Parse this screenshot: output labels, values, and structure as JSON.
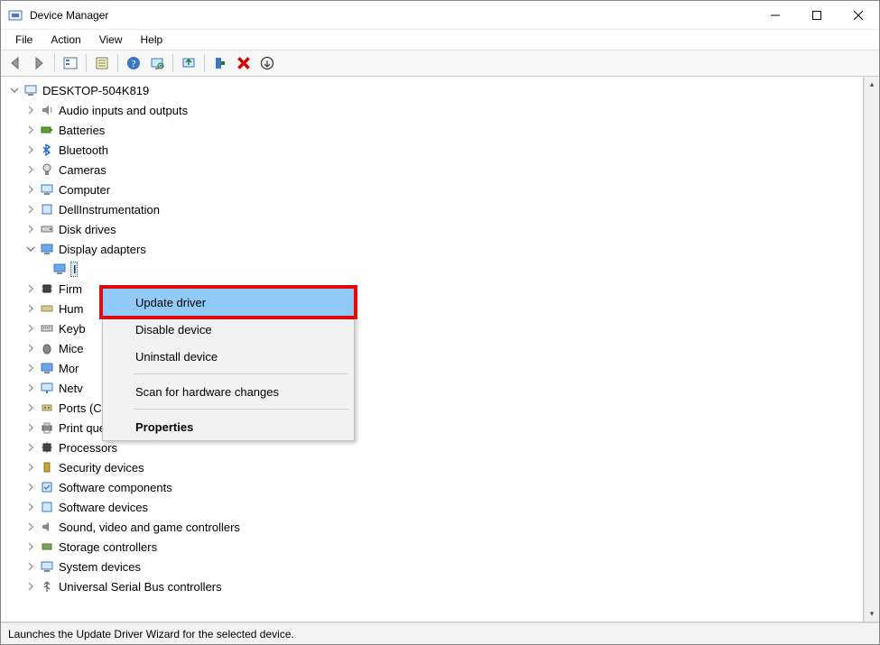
{
  "window": {
    "title": "Device Manager"
  },
  "menubar": {
    "items": [
      "File",
      "Action",
      "View",
      "Help"
    ]
  },
  "tree": {
    "root": "DESKTOP-504K819",
    "items": [
      "Audio inputs and outputs",
      "Batteries",
      "Bluetooth",
      "Cameras",
      "Computer",
      "DellInstrumentation",
      "Disk drives",
      "Display adapters",
      "Firm",
      "Hum",
      "Keyb",
      "Mice",
      "Mor",
      "Netv",
      "Ports (COM & LPT)",
      "Print queues",
      "Processors",
      "Security devices",
      "Software components",
      "Software devices",
      "Sound, video and game controllers",
      "Storage controllers",
      "System devices",
      "Universal Serial Bus controllers"
    ],
    "selected_child": "I"
  },
  "context_menu": {
    "update": "Update driver",
    "disable": "Disable device",
    "uninstall": "Uninstall device",
    "scan": "Scan for hardware changes",
    "properties": "Properties"
  },
  "status": "Launches the Update Driver Wizard for the selected device."
}
